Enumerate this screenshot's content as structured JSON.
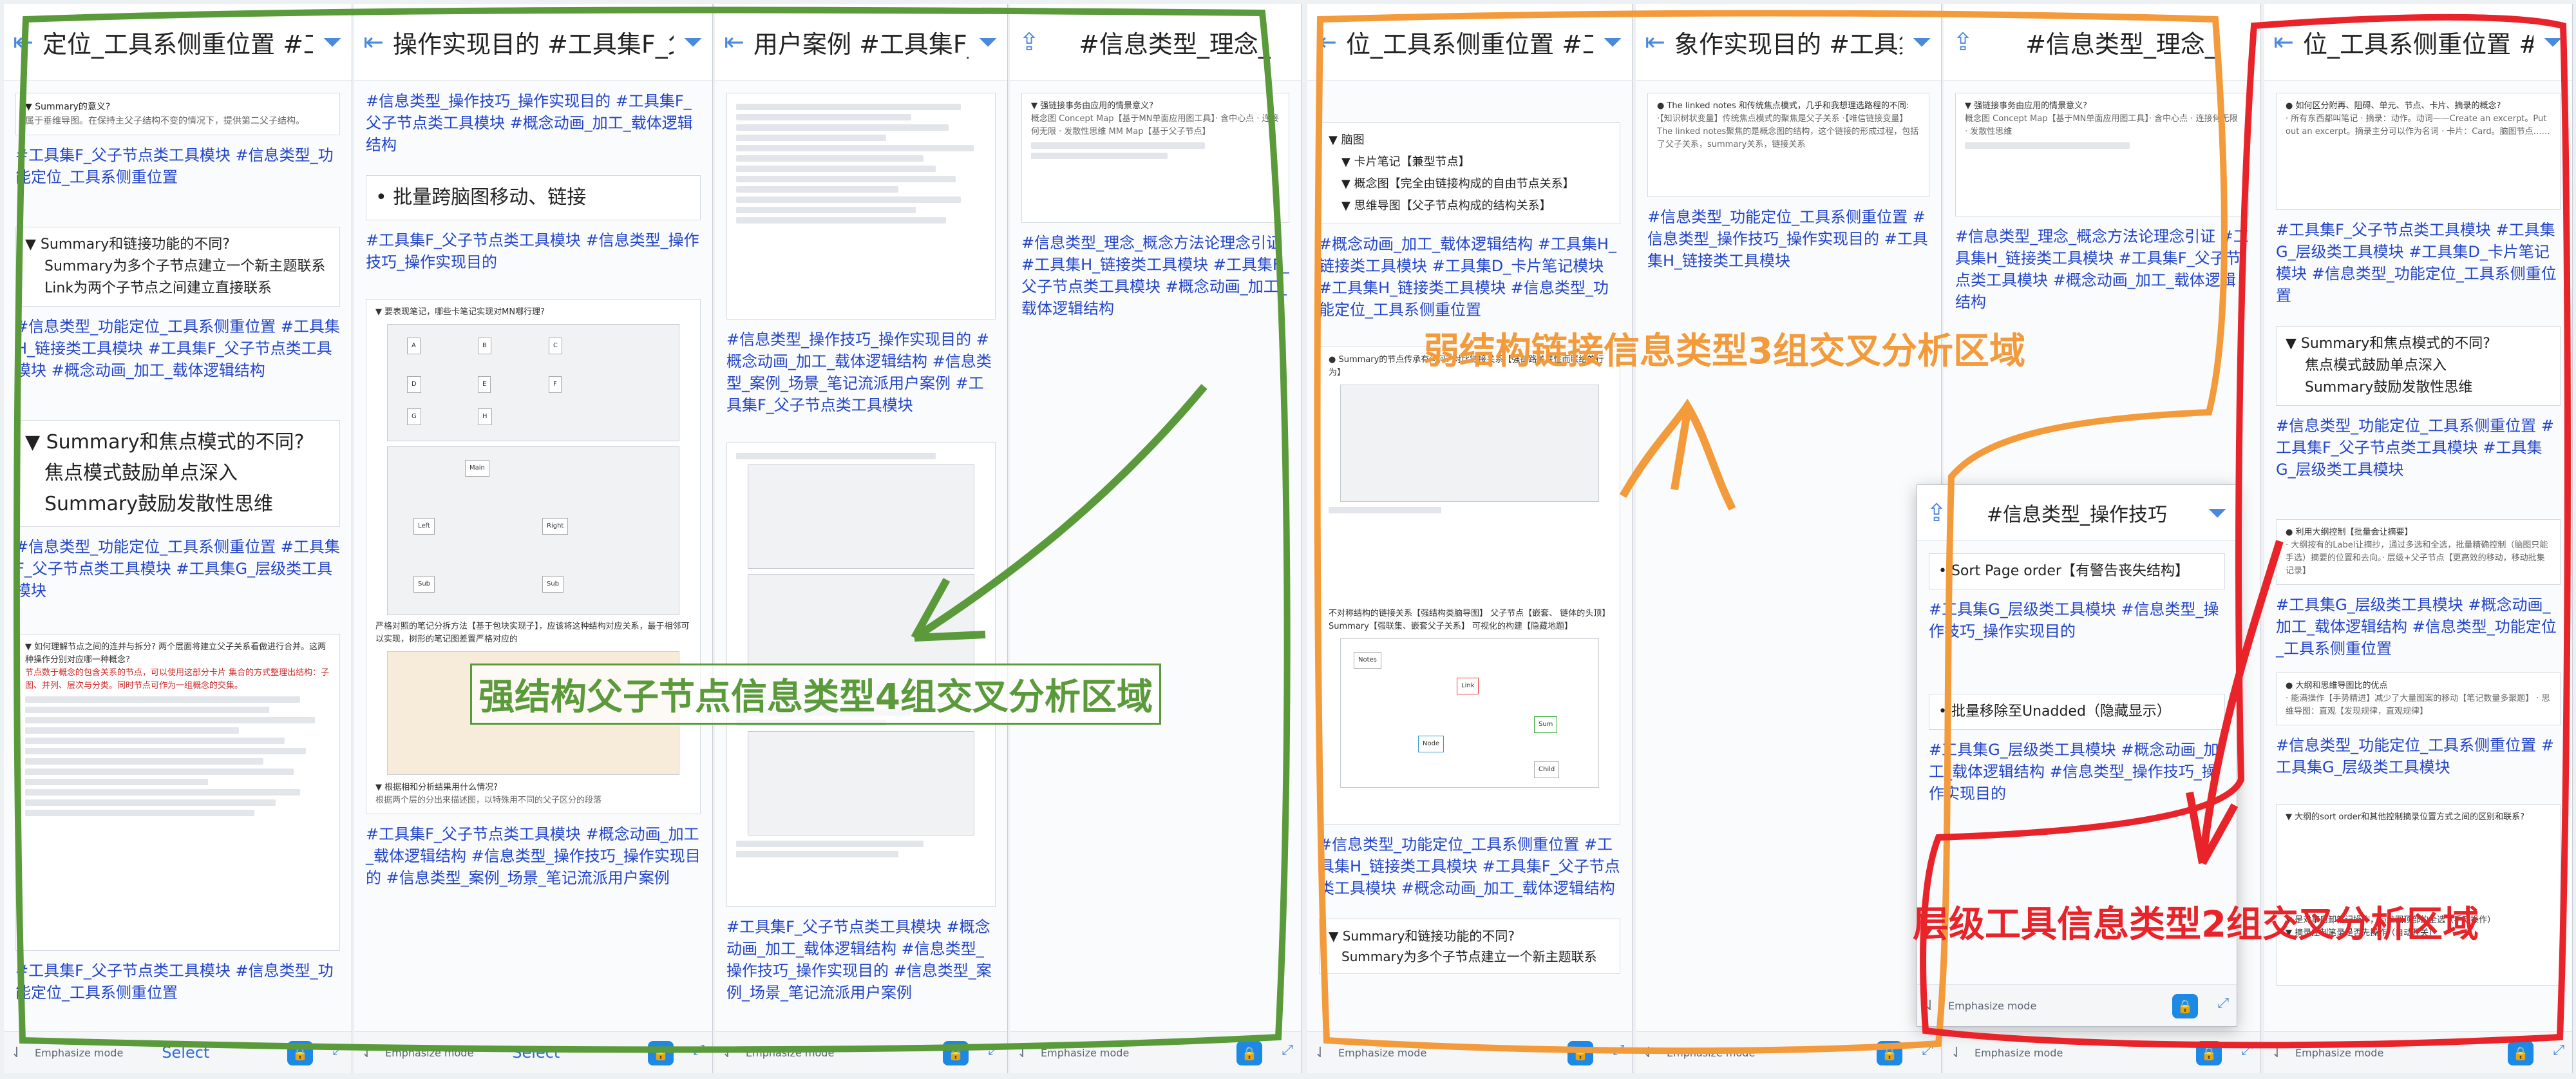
{
  "panels": [
    {
      "title": "定位_工具系侧重位置 #工具集",
      "footer": {
        "emph": "Emphasize mode",
        "select": "Select"
      }
    },
    {
      "title": "操作实现目的 #工具集F_父子节",
      "footer": {
        "emph": "Emphasize mode",
        "select": "Select"
      }
    },
    {
      "title": "用户案例 #工具集F_父",
      "footer": {
        "emph": "Emphasize mode"
      }
    },
    {
      "title": "#信息类型_理念_",
      "footer": {
        "emph": "Emphasize mode"
      }
    },
    {
      "title": "位_工具系侧重位置 #工具集",
      "footer": {
        "emph": "Emphasize mode"
      }
    },
    {
      "title": "象作实现目的 #工具集H_链",
      "footer": {
        "emph": "Emphasize mode"
      }
    },
    {
      "title": "#信息类型_理念_",
      "footer": {
        "emph": "Emphasize mode"
      }
    },
    {
      "title": "位_工具系侧重位置 #工具集G",
      "footer": {
        "emph": "Emphasize mode"
      }
    }
  ],
  "p1": {
    "c1_head": "▼ Summary的意义?",
    "c1_text": "属于垂维导图。在保持主父子结构不变的情况下，提供第二父子结构。",
    "tags1": "#工具集F_父子节点类工具模块 #信息类型_功能定位_工具系侧重位置",
    "c2_head": "▼ Summary和链接功能的不同?",
    "c2_l1": "Summary为多个子节点建立一个新主题联系",
    "c2_l2": "Link为两个子节点之间建立直接联系",
    "tags2": "#信息类型_功能定位_工具系侧重位置 #工具集H_链接类工具模块 #工具集F_父子节点类工具模块 #概念动画_加工_载体逻辑结构",
    "c3_head": "▼ Summary和焦点模式的不同?",
    "c3_l1": "焦点模式鼓励单点深入",
    "c3_l2": "Summary鼓励发散性思维",
    "tags3": "#信息类型_功能定位_工具系侧重位置 #工具集F_父子节点类工具模块 #工具集G_层级类工具模块",
    "c4_head": "▼ 如何理解节点之间的连并与拆分? 两个层面将建立父子关系看做进行合并。这两种操作分别对应哪一种概念?",
    "c4_text": "节点数于概念的包含关系的节点，可以使用这部分卡片 集合的方式整理出结构：子图、并列、层次与分类。同时节点可作为一组概念的交集。",
    "tags4": "#工具集F_父子节点类工具模块 #信息类型_功能定位_工具系侧重位置"
  },
  "p2": {
    "tags1": "#信息类型_操作技巧_操作实现目的 #工具集F_父子节点类工具模块 #概念动画_加工_载体逻辑结构",
    "c1": "• 批量跨脑图移动、链接",
    "tags2": "#工具集F_父子节点类工具模块 #信息类型_操作技巧_操作实现目的",
    "c2_head": "▼ 要表现笔记，哪些卡笔记实现对MN哪行理?",
    "c2_text": "严格对照的笔记分拆方法【基于包块实现子】，应该将这种结构对应关系，最于相邻可以实现，树形的笔记图差置严格对应的",
    "c3_head": "▼ 根据相和分析结果用什么情况?",
    "c3_text": "根据两个层的分出来描述图，以特殊用不同的父子区分的段落",
    "tags3": "#工具集F_父子节点类工具模块 #概念动画_加工_载体逻辑结构 #信息类型_操作技巧_操作实现目的 #信息类型_案例_场景_笔记流派用户案例"
  },
  "p3": {
    "tags1": "#信息类型_操作技巧_操作实现目的 #概念动画_加工_载体逻辑结构 #信息类型_案例_场景_笔记流派用户案例 #工具集F_父子节点类工具模块",
    "tags2": "#工具集F_父子节点类工具模块 #概念动画_加工_载体逻辑结构 #信息类型_操作技巧_操作实现目的 #信息类型_案例_场景_笔记流派用户案例"
  },
  "p4": {
    "c1_head": "▼ 强链接事务由应用的情景意义?",
    "c1_text": "概念图 Concept Map【基于MN单面应用图工具】· 含中心点 · 连接何无限 · 发散性思维 MM Map【基于父子节点】",
    "tags1": "#信息类型_理念_概念方法论理念引证 #工具集H_链接类工具模块 #工具集F_父子节点类工具模块 #概念动画_加工_载体逻辑结构"
  },
  "p5": {
    "c1_head": "▼ 脑图",
    "c1_l1": "▼ 卡片笔记【兼型节点】",
    "c1_l2": "▼ 概念图【完全由链接构成的自由节点关系】",
    "c1_l3": "▼ 思维导图【父子节点构成的结构关系】",
    "tags1": "#概念动画_加工_载体逻辑结构 #工具集H_链接类工具模块 #工具集D_卡片笔记模块 #工具集H_链接类工具模块 #信息类型_功能定位_工具系侧重位置",
    "c2_head": "● Summary的节点传承有问何? 对比链接关系【强链路关联性而联结的行为】",
    "c2_text": "不对称结构的链接关系【强结构类脑导图】 父子节点【嵌套、 链体的头顶】 Summary【强联集、嵌套父子关系】 可视化的构建【隐藏地题】",
    "tags2": "#信息类型_功能定位_工具系侧重位置 #工具集H_链接类工具模块 #工具集F_父子节点类工具模块 #概念动画_加工_载体逻辑结构",
    "c3_head": "▼ Summary和链接功能的不同?",
    "c3_l1": "Summary为多个子节点建立一个新主题联系"
  },
  "p6": {
    "c1_head": "● The linked notes 和传统焦点模式，几乎和我想理选路程的不同:",
    "c1_text": "·【知识树状变量】传统焦点模式的聚焦是父子关系 ·【唯信链接变量】The linked notes聚焦的是概念图的结构，这个链接的形成过程，包括了父子关系，summary关系，链接关系",
    "tags1": "#信息类型_功能定位_工具系侧重位置 #信息类型_操作技巧_操作实现目的 #工具集H_链接类工具模块"
  },
  "p7": {
    "c1_head": "▼ 强链接事务由应用的情景意义?",
    "c1_text": "概念图 Concept Map【基于MN单面应用图工具】· 含中心点 · 连接何无限 · 发散性思维",
    "tags1": "#信息类型_理念_概念方法论理念引证 #工具集H_链接类工具模块 #工具集F_父子节点类工具模块 #概念动画_加工_载体逻辑结构"
  },
  "popup": {
    "title": "#信息类型_操作技巧",
    "c1": "• Sort Page order【有警告丧失结构】",
    "tags1": "#工具集G_层级类工具模块 #信息类型_操作技巧_操作实现目的",
    "c2": "• 批量移除至Unadded（隐藏显示）",
    "tags2": "#工具集G_层级类工具模块 #概念动画_加工_载体逻辑结构 #信息类型_操作技巧_操作实现目的",
    "emph": "Emphasize mode"
  },
  "p8": {
    "c1_head": "● 如何区分附再、阻碍、单元、节点、卡片、摘录的概念?",
    "c1_text": "· 所有东西都叫笔记 · 摘录：动作。动词——Create an excerpt。Put out an excerpt。摘录主分可以作为名词 · 卡片：Card。脑图节点……",
    "tags1": "#工具集F_父子节点类工具模块 #工具集G_层级类工具模块 #工具集D_卡片笔记模块 #信息类型_功能定位_工具系侧重位置",
    "c2_head": "▼ Summary和焦点模式的不同?",
    "c2_l1": "焦点模式鼓励单点深入",
    "c2_l2": "Summary鼓励发散性思维",
    "tags2": "#信息类型_功能定位_工具系侧重位置 #工具集F_父子节点类工具模块 #工具集G_层级类工具模块",
    "c3_head": "● 利用大纲控制【批量会让摘要】",
    "c3_text": "· 大纲按有的Label让摘抄，通过多选和全选，批量精确控制（脑图只能手选）摘要的位置和去向。· 层级+父子节点【更高效的移动，移动批集记录】",
    "tags3": "#工具集G_层级类工具模块 #概念动画_加工_载体逻辑结构 #信息类型_功能定位_工具系侧重位置",
    "c4_head": "● 大纲和思维导图比的优点",
    "c4_text": "· 能满操作【手势精进】减少了大量图案的移动【笔记数量多聚题】 · 思维导图：直观【发现规律，直观规律】",
    "tags4": "#信息类型_功能定位_工具系侧重位置 #工具集G_层级类工具模块",
    "c5_head": "▼ 大纲的sort order和其他控制摘录位置方式之间的区别和联系?",
    "c5_l1": "▼ 是对事后卸笔记操作，与脑图顶部的全选（手动操作）",
    "c5_l2": "▼ 摘录控制笔录是否先操作（自动开关）"
  },
  "annotations": {
    "green": "强结构父子节点信息类型4组交叉分析区域",
    "orange": "弱结构链接信息类型3组交叉分析区域",
    "red": "层级工具信息类型2组交叉分析区域",
    "green_color": "#5a9a3a",
    "orange_color": "#f39a3b",
    "red_color": "#e8242a"
  },
  "icons": {
    "back": "collapse-left-icon",
    "filter": "filter-icon",
    "sort": "sort-icon",
    "lock": "lock-icon",
    "expand": "expand-icon",
    "share": "share-icon"
  }
}
